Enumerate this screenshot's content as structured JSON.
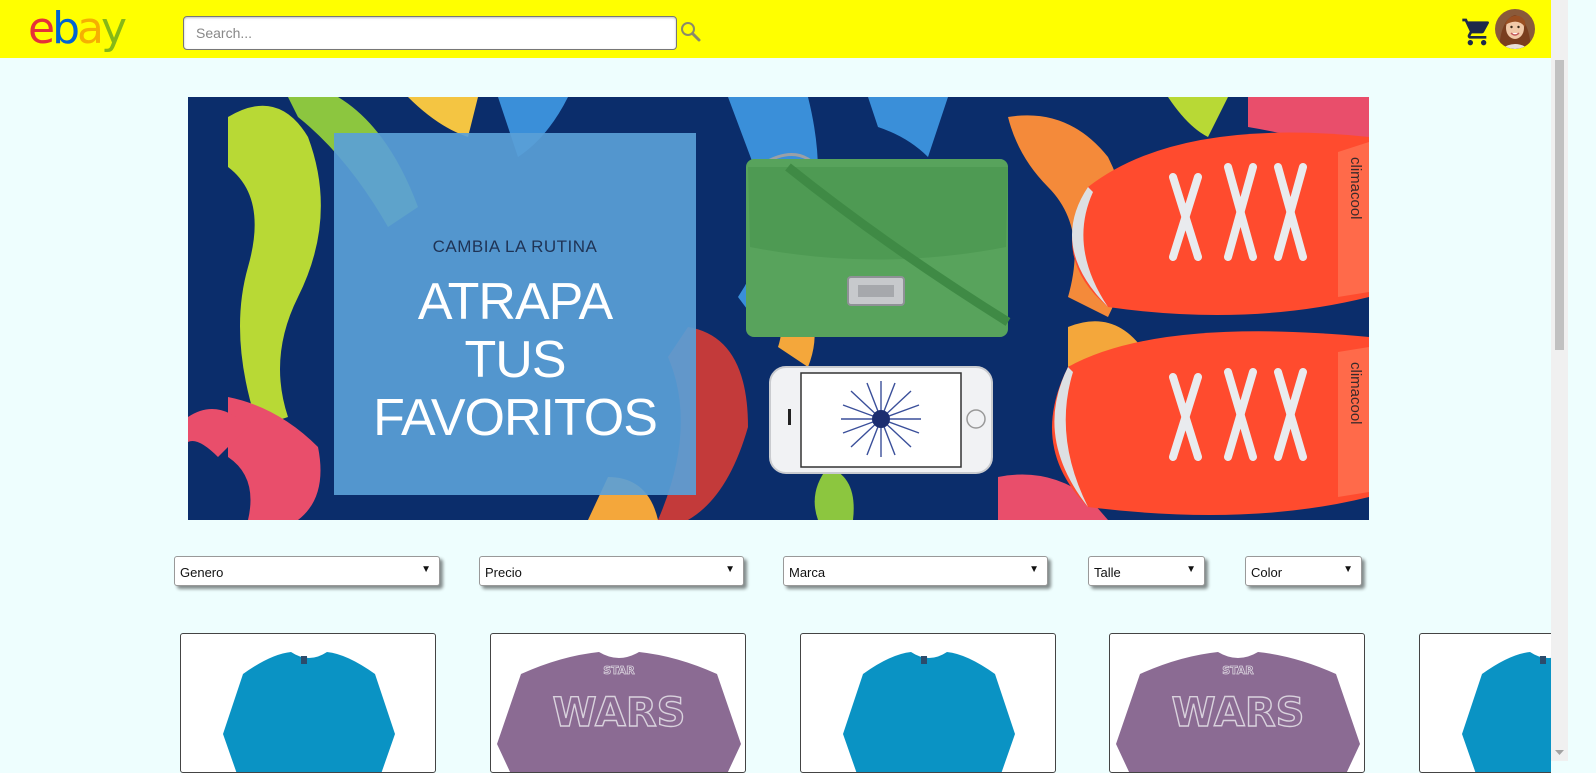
{
  "header": {
    "logo_letters": [
      "e",
      "b",
      "a",
      "y"
    ],
    "search": {
      "placeholder": "Search...",
      "value": ""
    },
    "icons": [
      "search-icon",
      "cart-icon",
      "avatar"
    ],
    "colors": {
      "bar": "#ffff00",
      "logo_e": "#e53238",
      "logo_b": "#0064d2",
      "logo_a": "#f5af02",
      "logo_y": "#86b817"
    }
  },
  "banner": {
    "kicker": "CAMBIA LA RUTINA",
    "headline_lines": [
      "ATRAPA",
      "TUS",
      "FAVORITOS"
    ],
    "shoe_brand": "climacool"
  },
  "filters": [
    {
      "label": "Genero"
    },
    {
      "label": "Precio"
    },
    {
      "label": "Marca"
    },
    {
      "label": "Talle"
    },
    {
      "label": "Color"
    }
  ],
  "products": [
    {
      "type": "blue-tshirt"
    },
    {
      "type": "starwars-tshirt",
      "print": [
        "STAR",
        "WARS"
      ]
    },
    {
      "type": "blue-tshirt"
    },
    {
      "type": "starwars-tshirt",
      "print": [
        "STAR",
        "WARS"
      ]
    },
    {
      "type": "blue-tshirt"
    }
  ]
}
